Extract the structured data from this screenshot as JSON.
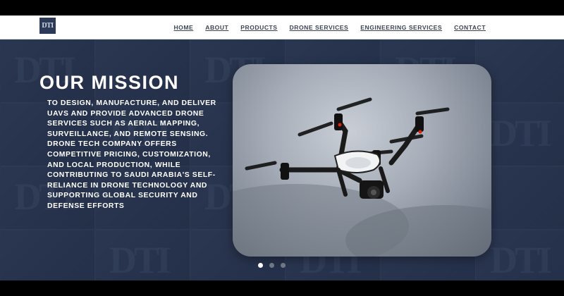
{
  "brand": {
    "logo_text": "DTI"
  },
  "nav": {
    "items": [
      {
        "label": "HOME"
      },
      {
        "label": "ABOUT"
      },
      {
        "label": "PRODUCTS"
      },
      {
        "label": "DRONE SERVICES"
      },
      {
        "label": "ENGINEERING SERVICES"
      },
      {
        "label": "CONTACT"
      }
    ]
  },
  "hero": {
    "title": "OUR MISSION",
    "text": "TO DESIGN, MANUFACTURE, AND DELIVER UAVS AND PROVIDE ADVANCED DRONE SERVICES SUCH AS AERIAL MAPPING, SURVEILLANCE, AND REMOTE SENSING. DRONE TECH COMPANY OFFERS COMPETITIVE PRICING, CUSTOMIZATION, AND LOCAL PRODUCTION, WHILE CONTRIBUTING TO SAUDI ARABIA'S SELF-RELIANCE IN DRONE TECHNOLOGY AND SUPPORTING GLOBAL SECURITY AND DEFENSE EFFORTS",
    "background_watermark": "DTI"
  },
  "carousel": {
    "slide_count": 3,
    "active_index": 0
  },
  "colors": {
    "hero_background": "#2a3650",
    "nav_text": "#3c4250",
    "logo_background": "#2c3a57"
  }
}
